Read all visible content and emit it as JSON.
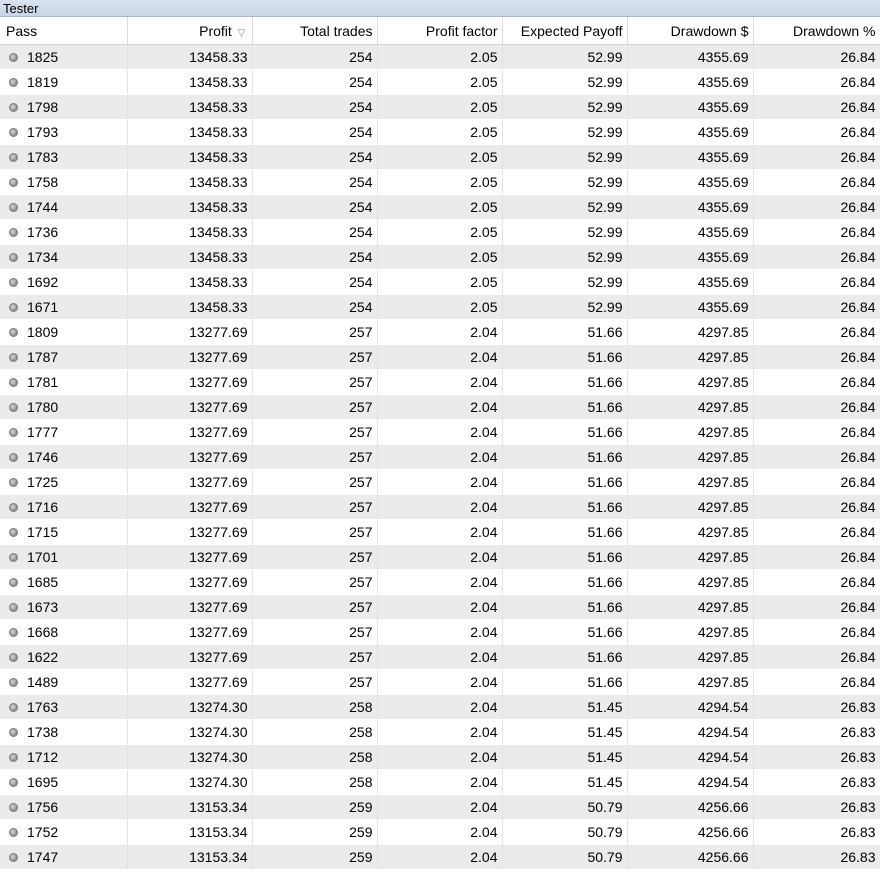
{
  "window": {
    "title": "Tester"
  },
  "columns": [
    {
      "label": "Pass",
      "align": "left"
    },
    {
      "label": "Profit",
      "sorted": "desc"
    },
    {
      "label": "Total trades"
    },
    {
      "label": "Profit factor"
    },
    {
      "label": "Expected Payoff"
    },
    {
      "label": "Drawdown $"
    },
    {
      "label": "Drawdown %"
    }
  ],
  "rows": [
    [
      "1825",
      "13458.33",
      "254",
      "2.05",
      "52.99",
      "4355.69",
      "26.84"
    ],
    [
      "1819",
      "13458.33",
      "254",
      "2.05",
      "52.99",
      "4355.69",
      "26.84"
    ],
    [
      "1798",
      "13458.33",
      "254",
      "2.05",
      "52.99",
      "4355.69",
      "26.84"
    ],
    [
      "1793",
      "13458.33",
      "254",
      "2.05",
      "52.99",
      "4355.69",
      "26.84"
    ],
    [
      "1783",
      "13458.33",
      "254",
      "2.05",
      "52.99",
      "4355.69",
      "26.84"
    ],
    [
      "1758",
      "13458.33",
      "254",
      "2.05",
      "52.99",
      "4355.69",
      "26.84"
    ],
    [
      "1744",
      "13458.33",
      "254",
      "2.05",
      "52.99",
      "4355.69",
      "26.84"
    ],
    [
      "1736",
      "13458.33",
      "254",
      "2.05",
      "52.99",
      "4355.69",
      "26.84"
    ],
    [
      "1734",
      "13458.33",
      "254",
      "2.05",
      "52.99",
      "4355.69",
      "26.84"
    ],
    [
      "1692",
      "13458.33",
      "254",
      "2.05",
      "52.99",
      "4355.69",
      "26.84"
    ],
    [
      "1671",
      "13458.33",
      "254",
      "2.05",
      "52.99",
      "4355.69",
      "26.84"
    ],
    [
      "1809",
      "13277.69",
      "257",
      "2.04",
      "51.66",
      "4297.85",
      "26.84"
    ],
    [
      "1787",
      "13277.69",
      "257",
      "2.04",
      "51.66",
      "4297.85",
      "26.84"
    ],
    [
      "1781",
      "13277.69",
      "257",
      "2.04",
      "51.66",
      "4297.85",
      "26.84"
    ],
    [
      "1780",
      "13277.69",
      "257",
      "2.04",
      "51.66",
      "4297.85",
      "26.84"
    ],
    [
      "1777",
      "13277.69",
      "257",
      "2.04",
      "51.66",
      "4297.85",
      "26.84"
    ],
    [
      "1746",
      "13277.69",
      "257",
      "2.04",
      "51.66",
      "4297.85",
      "26.84"
    ],
    [
      "1725",
      "13277.69",
      "257",
      "2.04",
      "51.66",
      "4297.85",
      "26.84"
    ],
    [
      "1716",
      "13277.69",
      "257",
      "2.04",
      "51.66",
      "4297.85",
      "26.84"
    ],
    [
      "1715",
      "13277.69",
      "257",
      "2.04",
      "51.66",
      "4297.85",
      "26.84"
    ],
    [
      "1701",
      "13277.69",
      "257",
      "2.04",
      "51.66",
      "4297.85",
      "26.84"
    ],
    [
      "1685",
      "13277.69",
      "257",
      "2.04",
      "51.66",
      "4297.85",
      "26.84"
    ],
    [
      "1673",
      "13277.69",
      "257",
      "2.04",
      "51.66",
      "4297.85",
      "26.84"
    ],
    [
      "1668",
      "13277.69",
      "257",
      "2.04",
      "51.66",
      "4297.85",
      "26.84"
    ],
    [
      "1622",
      "13277.69",
      "257",
      "2.04",
      "51.66",
      "4297.85",
      "26.84"
    ],
    [
      "1489",
      "13277.69",
      "257",
      "2.04",
      "51.66",
      "4297.85",
      "26.84"
    ],
    [
      "1763",
      "13274.30",
      "258",
      "2.04",
      "51.45",
      "4294.54",
      "26.83"
    ],
    [
      "1738",
      "13274.30",
      "258",
      "2.04",
      "51.45",
      "4294.54",
      "26.83"
    ],
    [
      "1712",
      "13274.30",
      "258",
      "2.04",
      "51.45",
      "4294.54",
      "26.83"
    ],
    [
      "1695",
      "13274.30",
      "258",
      "2.04",
      "51.45",
      "4294.54",
      "26.83"
    ],
    [
      "1756",
      "13153.34",
      "259",
      "2.04",
      "50.79",
      "4256.66",
      "26.83"
    ],
    [
      "1752",
      "13153.34",
      "259",
      "2.04",
      "50.79",
      "4256.66",
      "26.83"
    ],
    [
      "1747",
      "13153.34",
      "259",
      "2.04",
      "50.79",
      "4256.66",
      "26.83"
    ]
  ],
  "icons": {
    "row_marker": "pass-status-dot-icon",
    "sort": "sort-descending-icon"
  }
}
